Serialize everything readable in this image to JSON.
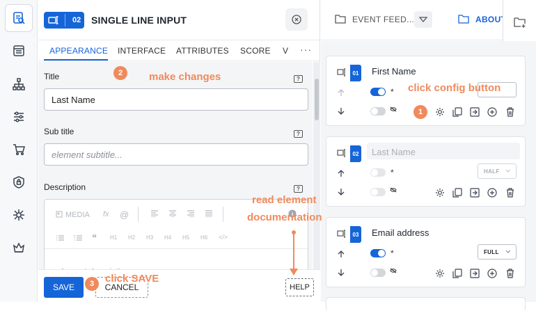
{
  "rail": {
    "items": [
      {
        "icon": "form-builder-icon",
        "active": true
      },
      {
        "icon": "list-panel-icon",
        "active": false
      },
      {
        "icon": "hierarchy-icon",
        "active": false
      },
      {
        "icon": "sliders-icon",
        "active": false
      },
      {
        "icon": "cart-icon",
        "active": false
      },
      {
        "icon": "shield-lock-icon",
        "active": false
      },
      {
        "icon": "integration-icon",
        "active": false
      },
      {
        "icon": "crown-icon",
        "active": false
      }
    ]
  },
  "editor": {
    "type_number": "02",
    "title": "SINGLE LINE INPUT",
    "tabs": [
      "APPEARANCE",
      "INTERFACE",
      "ATTRIBUTES",
      "SCORE",
      "V"
    ],
    "more": "···",
    "fields": {
      "title_label": "Title",
      "title_value": "Last Name",
      "subtitle_label": "Sub title",
      "subtitle_placeholder": "element subtitle...",
      "description_label": "Description",
      "description_placeholder": "element description..."
    },
    "toolbar": {
      "media": "MEDIA",
      "formula": "fx",
      "mention": "@",
      "quote": "❝",
      "headings": [
        "H1",
        "H2",
        "H3",
        "H4",
        "H5",
        "H6"
      ],
      "code": "</>"
    },
    "footer": {
      "save": "SAVE",
      "cancel": "CANCEL",
      "help": "HELP"
    }
  },
  "right": {
    "breadcrumbs": [
      "EVENT FEED...",
      "ABOUT"
    ],
    "cards": [
      {
        "number": "01",
        "title": "First Name",
        "required": "*",
        "width": ""
      },
      {
        "number": "02",
        "title": "Last Name",
        "required": "*",
        "width": "HALF"
      },
      {
        "number": "03",
        "title": "Email address",
        "required": "*",
        "width": "FULL"
      }
    ]
  },
  "annotations": {
    "step1_num": "1",
    "step1_text": "click config button",
    "step2_num": "2",
    "step2_text": "make changes",
    "step3_num": "3",
    "step3_text": "click SAVE",
    "doc_line1": "read element",
    "doc_line2": "documentation"
  },
  "colors": {
    "accent": "#1565d8",
    "annotation": "#f08a5d"
  }
}
